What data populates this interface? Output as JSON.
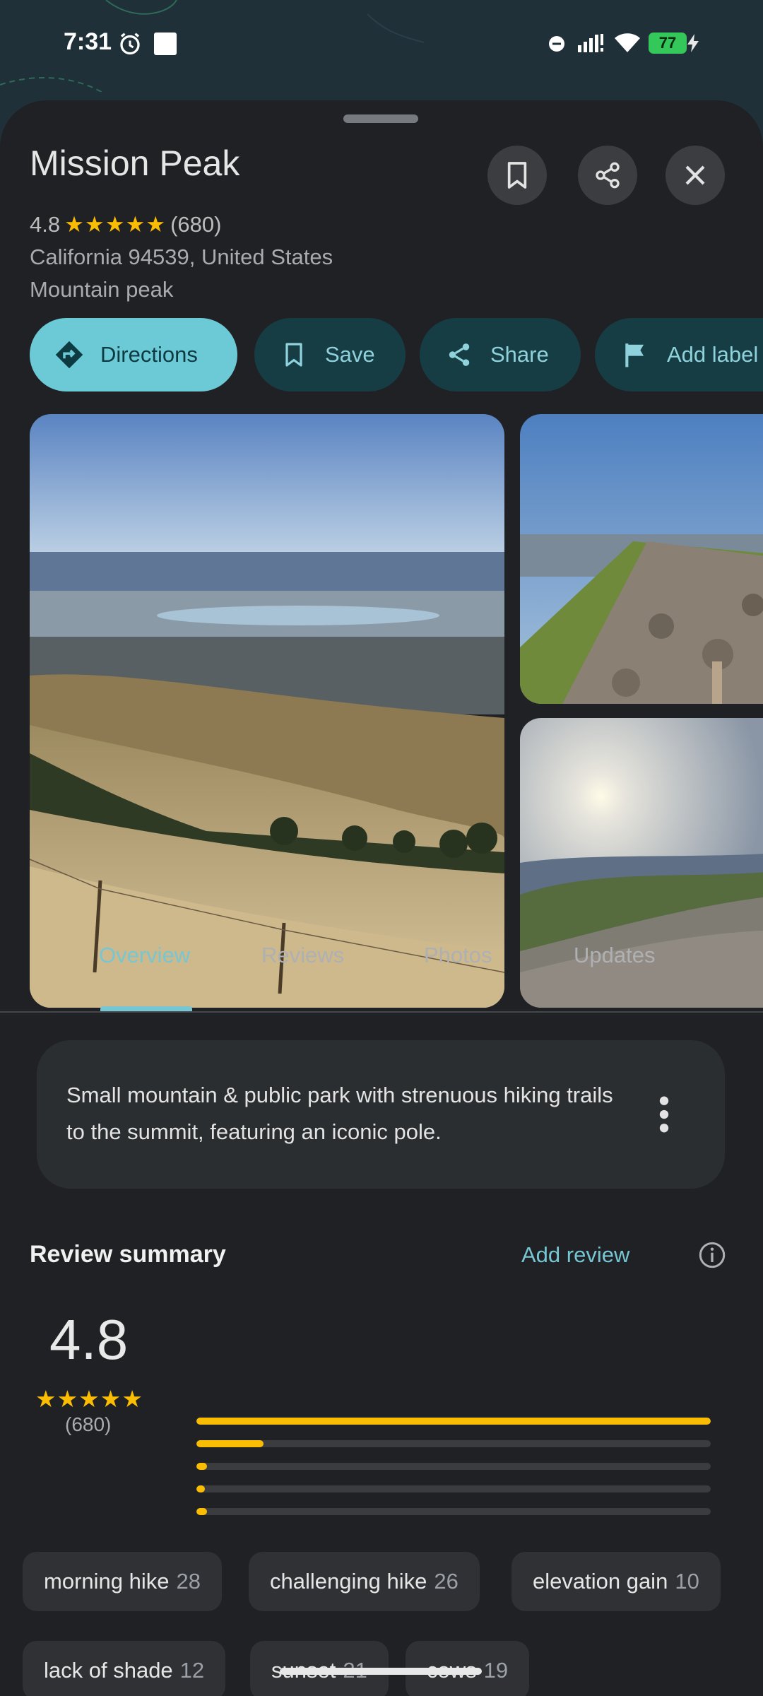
{
  "status_bar": {
    "time": "7:31",
    "battery": "77"
  },
  "place": {
    "name": "Mission Peak",
    "rating": "4.8",
    "stars": "★★★★★",
    "review_count": "(680)",
    "address": "California 94539, United States",
    "category": "Mountain peak"
  },
  "actions": {
    "directions": "Directions",
    "save": "Save",
    "share": "Share",
    "add_label": "Add label"
  },
  "tabs": [
    "Overview",
    "Reviews",
    "Photos",
    "Updates"
  ],
  "description": "Small mountain & public park with strenuous hiking trails to the summit, featuring an iconic pole.",
  "review_summary": {
    "title": "Review summary",
    "add_review": "Add review",
    "rating": "4.8",
    "stars": "★★★★★",
    "count": "(680)",
    "distribution": [
      {
        "stars": 5,
        "fraction": 1.0
      },
      {
        "stars": 4,
        "fraction": 0.13
      },
      {
        "stars": 3,
        "fraction": 0.02
      },
      {
        "stars": 2,
        "fraction": 0.01
      },
      {
        "stars": 1,
        "fraction": 0.02
      }
    ]
  },
  "topics": [
    {
      "label": "morning hike",
      "count": "28"
    },
    {
      "label": "challenging hike",
      "count": "26"
    },
    {
      "label": "elevation gain",
      "count": "10"
    },
    {
      "label": "lack of shade",
      "count": "12"
    },
    {
      "label": "sunset",
      "count": "21"
    },
    {
      "label": "cows",
      "count": "19"
    }
  ],
  "colors": {
    "accent": "#76c6d3",
    "primary_chip": "#6ccad6",
    "star": "#fbbc04",
    "sheet_bg": "#202124"
  },
  "icons": {
    "alarm": "alarm-icon",
    "bookmark": "bookmark-icon",
    "share": "share-icon",
    "close": "close-icon",
    "directions": "directions-icon",
    "flag": "flag-icon",
    "more": "more-vert-icon",
    "info": "info-icon"
  }
}
